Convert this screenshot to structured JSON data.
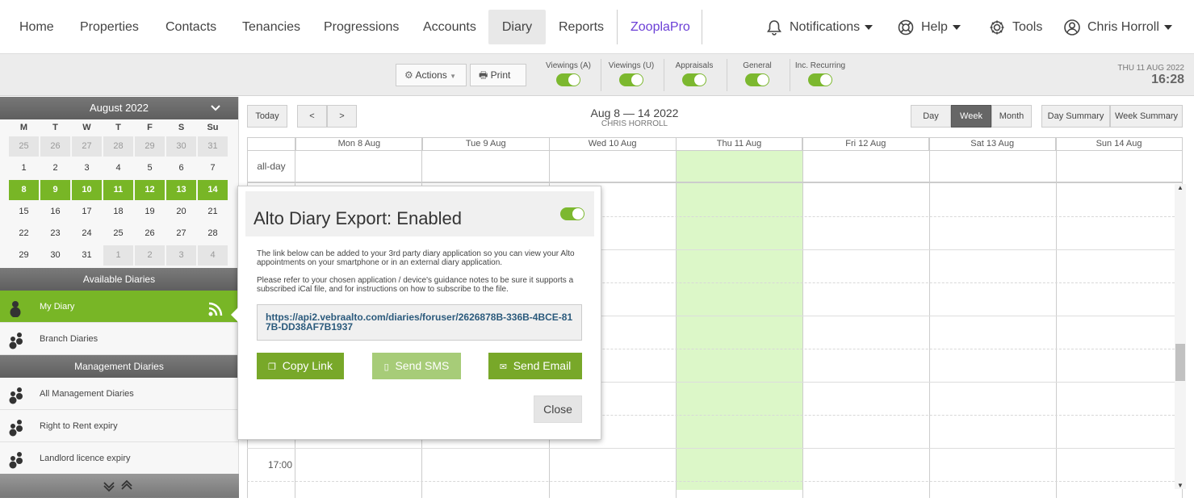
{
  "nav": {
    "items": [
      "Home",
      "Properties",
      "Contacts",
      "Tenancies",
      "Progressions",
      "Accounts",
      "Diary",
      "Reports"
    ],
    "zoopla": "ZooplaPro",
    "notifications": "Notifications",
    "help": "Help",
    "tools": "Tools",
    "user": "Chris Horroll"
  },
  "toolbar": {
    "actions": "Actions",
    "print": "Print",
    "toggles": [
      "Viewings (A)",
      "Viewings (U)",
      "Appraisals",
      "General",
      "Inc. Recurring"
    ],
    "date": "THU 11 AUG 2022",
    "time": "16:28"
  },
  "calendar": {
    "month": "August 2022",
    "dow": [
      "M",
      "T",
      "W",
      "T",
      "F",
      "S",
      "Su"
    ],
    "weeks": [
      [
        "25",
        "26",
        "27",
        "28",
        "29",
        "30",
        "31"
      ],
      [
        "1",
        "2",
        "3",
        "4",
        "5",
        "6",
        "7"
      ],
      [
        "8",
        "9",
        "10",
        "11",
        "12",
        "13",
        "14"
      ],
      [
        "15",
        "16",
        "17",
        "18",
        "19",
        "20",
        "21"
      ],
      [
        "22",
        "23",
        "24",
        "25",
        "26",
        "27",
        "28"
      ],
      [
        "29",
        "30",
        "31",
        "1",
        "2",
        "3",
        "4"
      ]
    ]
  },
  "sidebar": {
    "available": "Available Diaries",
    "my_diary": "My Diary",
    "branch": "Branch Diaries",
    "management": "Management Diaries",
    "mgmt_items": [
      "All Management Diaries",
      "Right to Rent expiry",
      "Landlord licence expiry"
    ]
  },
  "diary": {
    "today": "Today",
    "prev": "<",
    "next": ">",
    "range": "Aug 8 — 14 2022",
    "owner": "CHRIS HORROLL",
    "views": [
      "Day",
      "Week",
      "Month"
    ],
    "summaries": [
      "Day Summary",
      "Week Summary"
    ],
    "days": [
      "Mon 8 Aug",
      "Tue 9 Aug",
      "Wed 10 Aug",
      "Thu 11 Aug",
      "Fri 12 Aug",
      "Sat 13 Aug",
      "Sun 14 Aug"
    ],
    "allday": "all-day",
    "time_label": "17:00"
  },
  "modal": {
    "title": "Alto Diary Export: Enabled",
    "p1": "The link below can be added to your 3rd party diary application so you can view your Alto appointments on your smartphone or in an external diary application.",
    "p2": "Please refer to your chosen application / device's guidance notes to be sure it supports a subscribed iCal file, and for instructions on how to subscribe to the file.",
    "link": "https://api2.vebraalto.com/diaries/foruser/2626878B-336B-4BCE-817B-DD38AF7B1937",
    "copy": "Copy Link",
    "sms": "Send SMS",
    "email": "Send Email",
    "close": "Close"
  },
  "colors": {
    "accent": "#78b626",
    "zoopla": "#6b3fd6",
    "today": "#dcf7c8"
  }
}
